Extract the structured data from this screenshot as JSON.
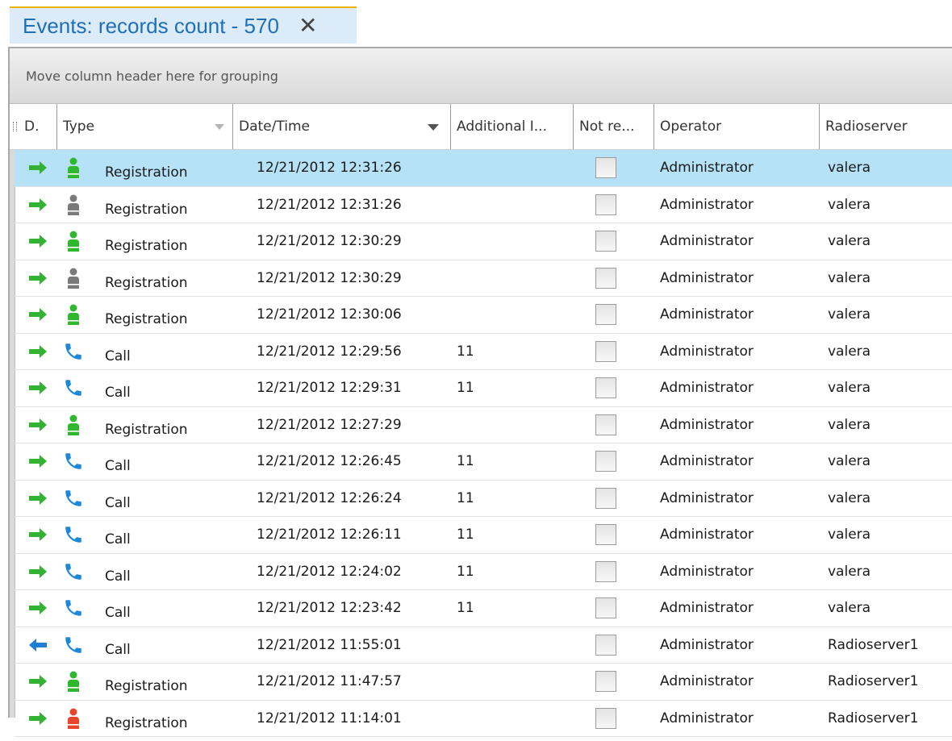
{
  "tab": {
    "title": "Events: records count - 570",
    "close_glyph": "✕"
  },
  "grid": {
    "group_hint": "Move column header here for grouping",
    "columns": {
      "direction": "D.",
      "type": "Type",
      "datetime": "Date/Time",
      "additional": "Additional I...",
      "not_read": "Not re...",
      "operator": "Operator",
      "radioserver": "Radioserver"
    },
    "colors": {
      "arrow_in": "#33b233",
      "arrow_out": "#1e7fd4",
      "person_green": "#2fb82f",
      "person_gray": "#7a7a7a",
      "person_red": "#e8452a",
      "phone": "#1e88d8",
      "selected_row": "#b5e2f6"
    },
    "rows": [
      {
        "arrow": "right",
        "icon": "person",
        "icon_color": "green",
        "type": "Registration",
        "datetime": "12/21/2012 12:31:26",
        "additional": "",
        "operator": "Administrator",
        "radioserver": "valera",
        "selected": true
      },
      {
        "arrow": "right",
        "icon": "person",
        "icon_color": "gray",
        "type": "Registration",
        "datetime": "12/21/2012 12:31:26",
        "additional": "",
        "operator": "Administrator",
        "radioserver": "valera"
      },
      {
        "arrow": "right",
        "icon": "person",
        "icon_color": "green",
        "type": "Registration",
        "datetime": "12/21/2012 12:30:29",
        "additional": "",
        "operator": "Administrator",
        "radioserver": "valera"
      },
      {
        "arrow": "right",
        "icon": "person",
        "icon_color": "gray",
        "type": "Registration",
        "datetime": "12/21/2012 12:30:29",
        "additional": "",
        "operator": "Administrator",
        "radioserver": "valera"
      },
      {
        "arrow": "right",
        "icon": "person",
        "icon_color": "green",
        "type": "Registration",
        "datetime": "12/21/2012 12:30:06",
        "additional": "",
        "operator": "Administrator",
        "radioserver": "valera"
      },
      {
        "arrow": "right",
        "icon": "phone",
        "icon_color": "blue",
        "type": "Call",
        "datetime": "12/21/2012 12:29:56",
        "additional": "11",
        "operator": "Administrator",
        "radioserver": "valera"
      },
      {
        "arrow": "right",
        "icon": "phone",
        "icon_color": "blue",
        "type": "Call",
        "datetime": "12/21/2012 12:29:31",
        "additional": "11",
        "operator": "Administrator",
        "radioserver": "valera"
      },
      {
        "arrow": "right",
        "icon": "person",
        "icon_color": "green",
        "type": "Registration",
        "datetime": "12/21/2012 12:27:29",
        "additional": "",
        "operator": "Administrator",
        "radioserver": "valera"
      },
      {
        "arrow": "right",
        "icon": "phone",
        "icon_color": "blue",
        "type": "Call",
        "datetime": "12/21/2012 12:26:45",
        "additional": "11",
        "operator": "Administrator",
        "radioserver": "valera"
      },
      {
        "arrow": "right",
        "icon": "phone",
        "icon_color": "blue",
        "type": "Call",
        "datetime": "12/21/2012 12:26:24",
        "additional": "11",
        "operator": "Administrator",
        "radioserver": "valera"
      },
      {
        "arrow": "right",
        "icon": "phone",
        "icon_color": "blue",
        "type": "Call",
        "datetime": "12/21/2012 12:26:11",
        "additional": "11",
        "operator": "Administrator",
        "radioserver": "valera"
      },
      {
        "arrow": "right",
        "icon": "phone",
        "icon_color": "blue",
        "type": "Call",
        "datetime": "12/21/2012 12:24:02",
        "additional": "11",
        "operator": "Administrator",
        "radioserver": "valera"
      },
      {
        "arrow": "right",
        "icon": "phone",
        "icon_color": "blue",
        "type": "Call",
        "datetime": "12/21/2012 12:23:42",
        "additional": "11",
        "operator": "Administrator",
        "radioserver": "valera"
      },
      {
        "arrow": "left",
        "icon": "phone",
        "icon_color": "blue",
        "type": "Call",
        "datetime": "12/21/2012 11:55:01",
        "additional": "",
        "operator": "Administrator",
        "radioserver": "Radioserver1"
      },
      {
        "arrow": "right",
        "icon": "person",
        "icon_color": "green",
        "type": "Registration",
        "datetime": "12/21/2012 11:47:57",
        "additional": "",
        "operator": "Administrator",
        "radioserver": "Radioserver1"
      },
      {
        "arrow": "right",
        "icon": "person",
        "icon_color": "red",
        "type": "Registration",
        "datetime": "12/21/2012 11:14:01",
        "additional": "",
        "operator": "Administrator",
        "radioserver": "Radioserver1"
      }
    ]
  }
}
